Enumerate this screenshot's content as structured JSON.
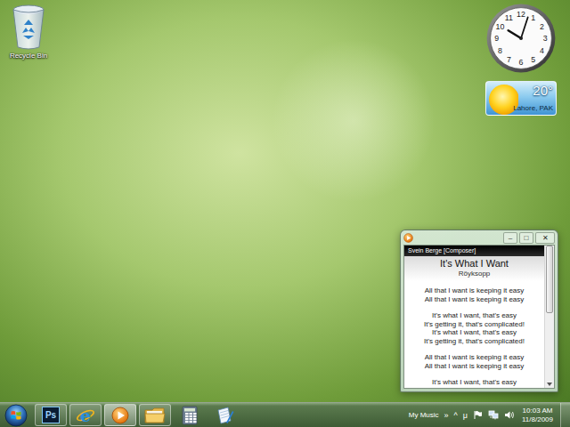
{
  "desktop_icons": [
    {
      "label": "Recycle Bin"
    }
  ],
  "clock": {
    "numerals": [
      "12",
      "1",
      "2",
      "3",
      "4",
      "5",
      "6",
      "7",
      "8",
      "9",
      "10",
      "11"
    ],
    "hour": 10,
    "minute": 3
  },
  "weather": {
    "temperature": "20°",
    "location": "Lahore, PAK"
  },
  "media_window": {
    "controls": [
      "–",
      "□",
      "✕"
    ],
    "composer": "Svein Berge [Composer]",
    "title": "It's What I Want",
    "artist": "Röyksopp",
    "lyrics": [
      [
        "All that I want is keeping it easy",
        "All that I want is keeping it easy"
      ],
      [
        "It's what I want, that's easy",
        "It's getting it, that's complicated!",
        "It's what I want, that's easy",
        "It's getting it, that's complicated!"
      ],
      [
        "All that I want is keeping it easy",
        "All that I want is keeping it easy"
      ],
      [
        "It's what I want, that's easy"
      ]
    ],
    "scrollbar": {
      "position": 0,
      "size": 0.5
    }
  },
  "taskbar": {
    "apps": [
      {
        "kind": "photoshop",
        "label": "Ps",
        "running": true,
        "selected": false
      },
      {
        "kind": "internet-explorer",
        "label": "e",
        "running": true,
        "selected": false
      },
      {
        "kind": "media-player",
        "running": true,
        "selected": true
      },
      {
        "kind": "explorer",
        "running": true,
        "selected": false
      },
      {
        "kind": "calculator",
        "running": false,
        "selected": false
      },
      {
        "kind": "writer",
        "running": false,
        "selected": false
      }
    ]
  },
  "tray": {
    "toolbar": "My Music",
    "overflow": "»",
    "expand": "^",
    "input": "μ",
    "time": "10:03 AM",
    "date": "11/8/2009"
  }
}
